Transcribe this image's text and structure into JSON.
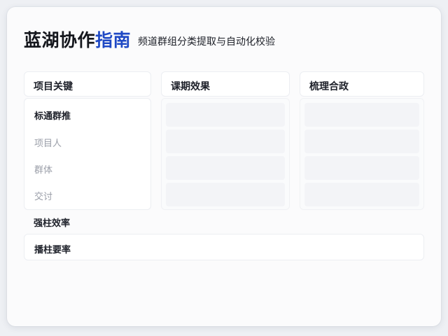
{
  "header": {
    "title_primary": "蓝湖协作",
    "title_accent": "指南",
    "subtitle": "频道群组分类提取与自动化校验"
  },
  "columns": [
    {
      "label": "项目关键"
    },
    {
      "label": "课期效果"
    },
    {
      "label": "梳理合政"
    }
  ],
  "menu": {
    "items": [
      {
        "label": "标通群推",
        "state": "active"
      },
      {
        "label": "项目人",
        "state": "muted"
      },
      {
        "label": "群体",
        "state": "muted"
      },
      {
        "label": "交讨",
        "state": "muted"
      }
    ]
  },
  "rows": [
    {
      "label": "强柱效率"
    },
    {
      "label": "播柱要率"
    }
  ],
  "colors": {
    "accent": "#1f49c5",
    "background": "#fbfbfc",
    "muted_text": "#9a9ea8"
  }
}
